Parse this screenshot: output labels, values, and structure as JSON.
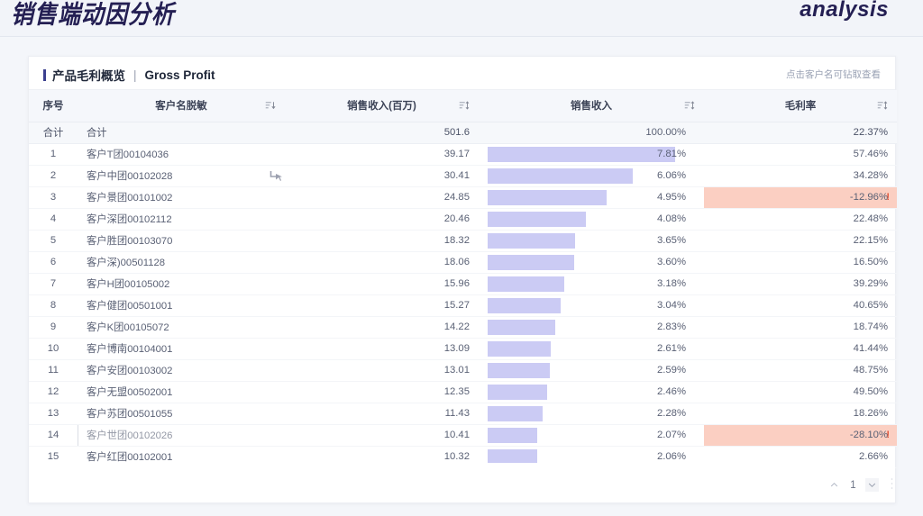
{
  "banner": {
    "title": "销售端动因分析",
    "logo": "analysis"
  },
  "card": {
    "title_cn": "产品毛利概览",
    "title_sep": "|",
    "title_en": "Gross Profit",
    "hint": "点击客户名可钻取查看"
  },
  "table": {
    "headers": {
      "index": "序号",
      "name": "客户名脱敏",
      "revenue": "销售收入(百万)",
      "share": "销售收入",
      "margin": "毛利率"
    },
    "total": {
      "index": "合计",
      "name": "合计",
      "revenue": "501.6",
      "share": "100.00%",
      "margin": "22.37%"
    },
    "rows": [
      {
        "index": "1",
        "name": "客户T团00104036",
        "revenue": "39.17",
        "share": "7.81%",
        "share_pct": 7.81,
        "margin": "57.46%",
        "negative": false
      },
      {
        "index": "2",
        "name": "客户中团00102028",
        "revenue": "30.41",
        "share": "6.06%",
        "share_pct": 6.06,
        "margin": "34.28%",
        "negative": false
      },
      {
        "index": "3",
        "name": "客户景团00101002",
        "revenue": "24.85",
        "share": "4.95%",
        "share_pct": 4.95,
        "margin": "-12.96%",
        "negative": true
      },
      {
        "index": "4",
        "name": "客户深团00102112",
        "revenue": "20.46",
        "share": "4.08%",
        "share_pct": 4.08,
        "margin": "22.48%",
        "negative": false
      },
      {
        "index": "5",
        "name": "客户胜团00103070",
        "revenue": "18.32",
        "share": "3.65%",
        "share_pct": 3.65,
        "margin": "22.15%",
        "negative": false
      },
      {
        "index": "6",
        "name": "客户深)00501128",
        "revenue": "18.06",
        "share": "3.60%",
        "share_pct": 3.6,
        "margin": "16.50%",
        "negative": false
      },
      {
        "index": "7",
        "name": "客户H团00105002",
        "revenue": "15.96",
        "share": "3.18%",
        "share_pct": 3.18,
        "margin": "39.29%",
        "negative": false
      },
      {
        "index": "8",
        "name": "客户健团00501001",
        "revenue": "15.27",
        "share": "3.04%",
        "share_pct": 3.04,
        "margin": "40.65%",
        "negative": false
      },
      {
        "index": "9",
        "name": "客户K团00105072",
        "revenue": "14.22",
        "share": "2.83%",
        "share_pct": 2.83,
        "margin": "18.74%",
        "negative": false
      },
      {
        "index": "10",
        "name": "客户博南00104001",
        "revenue": "13.09",
        "share": "2.61%",
        "share_pct": 2.61,
        "margin": "41.44%",
        "negative": false
      },
      {
        "index": "11",
        "name": "客户安团00103002",
        "revenue": "13.01",
        "share": "2.59%",
        "share_pct": 2.59,
        "margin": "48.75%",
        "negative": false
      },
      {
        "index": "12",
        "name": "客户无盟00502001",
        "revenue": "12.35",
        "share": "2.46%",
        "share_pct": 2.46,
        "margin": "49.50%",
        "negative": false
      },
      {
        "index": "13",
        "name": "客户苏团00501055",
        "revenue": "11.43",
        "share": "2.28%",
        "share_pct": 2.28,
        "margin": "18.26%",
        "negative": false
      },
      {
        "index": "14",
        "name": "客户世团00102026",
        "revenue": "10.41",
        "share": "2.07%",
        "share_pct": 2.07,
        "margin": "-28.10%",
        "negative": true
      },
      {
        "index": "15",
        "name": "客户红团00102001",
        "revenue": "10.32",
        "share": "2.06%",
        "share_pct": 2.06,
        "margin": "2.66%",
        "negative": false
      }
    ],
    "warn_symbol": "!",
    "focused_row_index": 13,
    "cursor_row_index": 1
  },
  "pagination": {
    "page": "1"
  },
  "chart_data": {
    "type": "bar",
    "title": "产品毛利概览 | Gross Profit",
    "xlabel": "销售收入",
    "ylabel": "客户名脱敏",
    "categories": [
      "客户T团00104036",
      "客户中团00102028",
      "客户景团00101002",
      "客户深团00102112",
      "客户胜团00103070",
      "客户深)00501128",
      "客户H团00105002",
      "客户健团00501001",
      "客户K团00105072",
      "客户博南00104001",
      "客户安团00103002",
      "客户无盟00502001",
      "客户苏团00501055",
      "客户世团00102026",
      "客户红团00102001"
    ],
    "series": [
      {
        "name": "销售收入(百万)",
        "values": [
          39.17,
          30.41,
          24.85,
          20.46,
          18.32,
          18.06,
          15.96,
          15.27,
          14.22,
          13.09,
          13.01,
          12.35,
          11.43,
          10.41,
          10.32
        ]
      },
      {
        "name": "销售收入占比%",
        "values": [
          7.81,
          6.06,
          4.95,
          4.08,
          3.65,
          3.6,
          3.18,
          3.04,
          2.83,
          2.61,
          2.59,
          2.46,
          2.28,
          2.07,
          2.06
        ]
      },
      {
        "name": "毛利率%",
        "values": [
          57.46,
          34.28,
          -12.96,
          22.48,
          22.15,
          16.5,
          39.29,
          40.65,
          18.74,
          41.44,
          48.75,
          49.5,
          18.26,
          -28.1,
          2.66
        ]
      }
    ],
    "total": {
      "销售收入(百万)": 501.6,
      "销售收入占比%": 100.0,
      "毛利率%": 22.37
    },
    "grid": false,
    "legend": "none"
  }
}
